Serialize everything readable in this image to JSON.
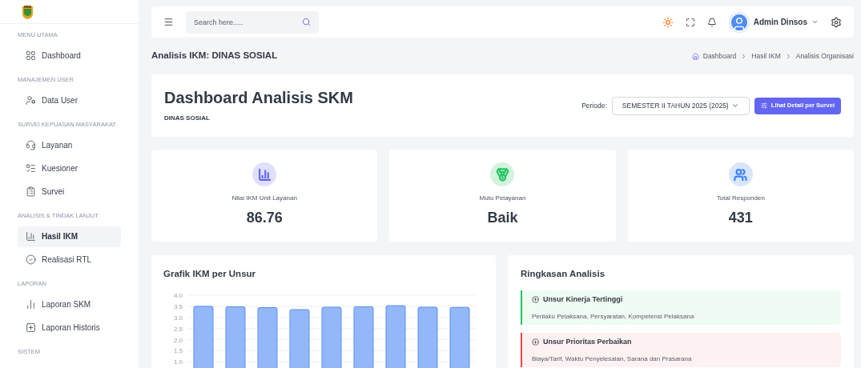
{
  "header": {
    "search": {
      "placeholder": "Search here....."
    },
    "user": {
      "name": "Admin Dinsos"
    }
  },
  "sidebar": {
    "sections": [
      {
        "title": "MENU UTAMA",
        "items": [
          {
            "label": "Dashboard",
            "selected": false
          }
        ]
      },
      {
        "title": "MANAJEMEN USER",
        "items": [
          {
            "label": "Data User",
            "selected": false
          }
        ]
      },
      {
        "title": "SURVEI KEPUASAN MASYARAKAT",
        "items": [
          {
            "label": "Layanan",
            "selected": false
          },
          {
            "label": "Kuesioner",
            "selected": false
          },
          {
            "label": "Survei",
            "selected": false
          }
        ]
      },
      {
        "title": "ANALISIS & TINDAK LANJUT",
        "items": [
          {
            "label": "Hasil IKM",
            "selected": true
          },
          {
            "label": "Realisasi RTL",
            "selected": false
          }
        ]
      },
      {
        "title": "LAPORAN",
        "items": [
          {
            "label": "Laporan SKM",
            "selected": false
          },
          {
            "label": "Laporan Historis",
            "selected": false
          }
        ]
      },
      {
        "title": "SISTEM"
      }
    ]
  },
  "page": {
    "title": "Analisis IKM: DINAS SOSIAL",
    "breadcrumb": [
      "Dashboard",
      "Hasil IKM",
      "Analisis Organisasi"
    ]
  },
  "hero": {
    "title": "Dashboard Analisis SKM",
    "subtitle": "DINAS SOSIAL",
    "period_label": "Periode:",
    "period_value": "SEMESTER II TAHUN 2025 (2025)",
    "button": "Lihat Detail per Survei"
  },
  "stats": [
    {
      "label": "Nilai IKM Unit Layanan",
      "value": "86.76",
      "color": "#6366f1"
    },
    {
      "label": "Mutu Pelayanan",
      "value": "Baik",
      "color": "#22c55e"
    },
    {
      "label": "Total Responden",
      "value": "431",
      "color": "#3b82f6"
    }
  ],
  "chart_card": {
    "title": "Grafik IKM per Unsur",
    "chart_data": {
      "type": "bar",
      "grid": true,
      "ylim": [
        0.0,
        4.0
      ],
      "yticks": [
        {
          "value": 1.0,
          "label": "1.0"
        },
        {
          "value": 1.5,
          "label": "1.5"
        },
        {
          "value": 2.0,
          "label": "2.0"
        },
        {
          "value": 2.5,
          "label": "2.5"
        },
        {
          "value": 3.0,
          "label": "3.0"
        },
        {
          "value": 3.5,
          "label": "3.5"
        },
        {
          "value": 4.0,
          "label": "4.0"
        }
      ],
      "series": [
        {
          "color": "#93b8f8",
          "values": [
            3.5,
            3.48,
            3.44,
            3.35,
            3.46,
            3.48,
            3.53,
            3.46,
            3.45
          ]
        }
      ]
    }
  },
  "summary": {
    "title": "Ringkasan Analisis",
    "items": [
      {
        "kind": "highest",
        "title": "Unsur Kinerja Tertinggi",
        "text": "Perilaku Pelaksana, Persyaratan, Kompetensi Pelaksana"
      },
      {
        "kind": "priority",
        "title": "Unsur Prioritas Perbaikan",
        "text": "Biaya/Tarif, Waktu Penyelesaian, Sarana dan Prasarana"
      }
    ]
  }
}
